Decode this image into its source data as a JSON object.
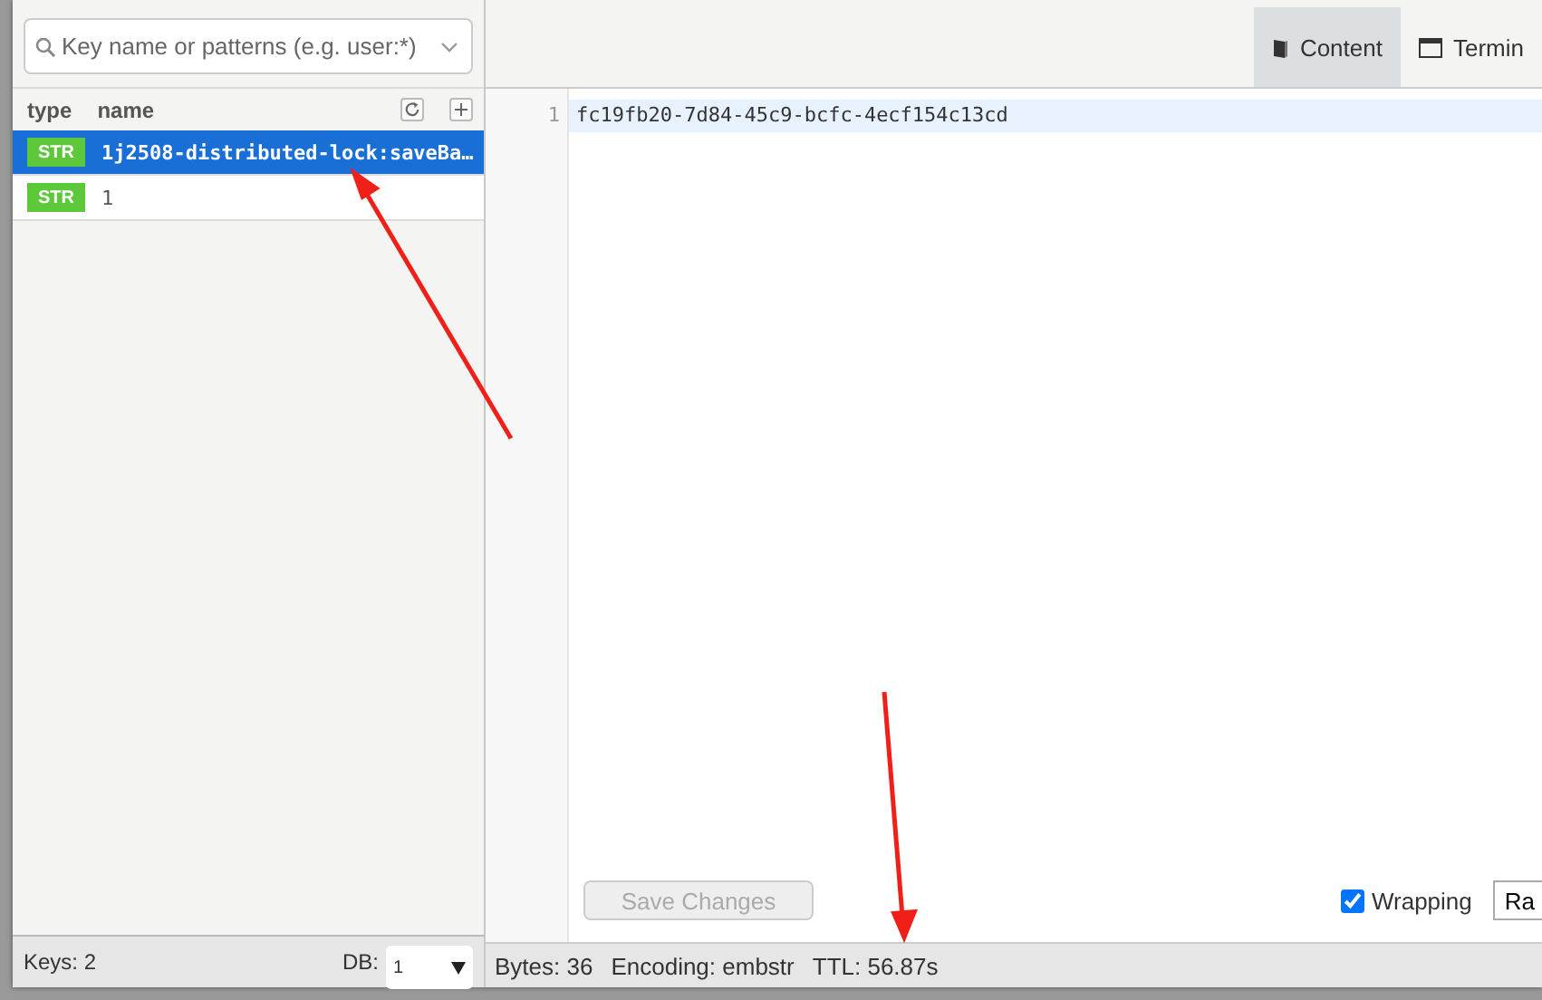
{
  "search": {
    "placeholder": "Key name or patterns (e.g. user:*)"
  },
  "key_list": {
    "columns": [
      "type",
      "name"
    ],
    "rows": [
      {
        "type": "STR",
        "name": "1j2508-distributed-lock:saveBa…",
        "selected": true
      },
      {
        "type": "STR",
        "name": "1",
        "selected": false
      }
    ]
  },
  "footer": {
    "keys": "Keys: 2",
    "db_label": "DB:",
    "db_value": "1"
  },
  "tabs": [
    {
      "label": "Content",
      "kind": "book",
      "selected": true
    },
    {
      "label": "Termin",
      "kind": "window",
      "selected": false
    }
  ],
  "editor": {
    "lines": [
      {
        "number": "1",
        "text": "fc19fb20-7d84-45c9-bcfc-4ecf154c13cd",
        "current": true
      }
    ]
  },
  "save_button": {
    "label": "Save Changes",
    "disabled": true
  },
  "wrapping": {
    "label": "Wrapping",
    "checked": true
  },
  "format_select": {
    "value": "Ra"
  },
  "status": [
    "Bytes: 36",
    "Encoding: embstr",
    "TTL: 56.87s"
  ]
}
